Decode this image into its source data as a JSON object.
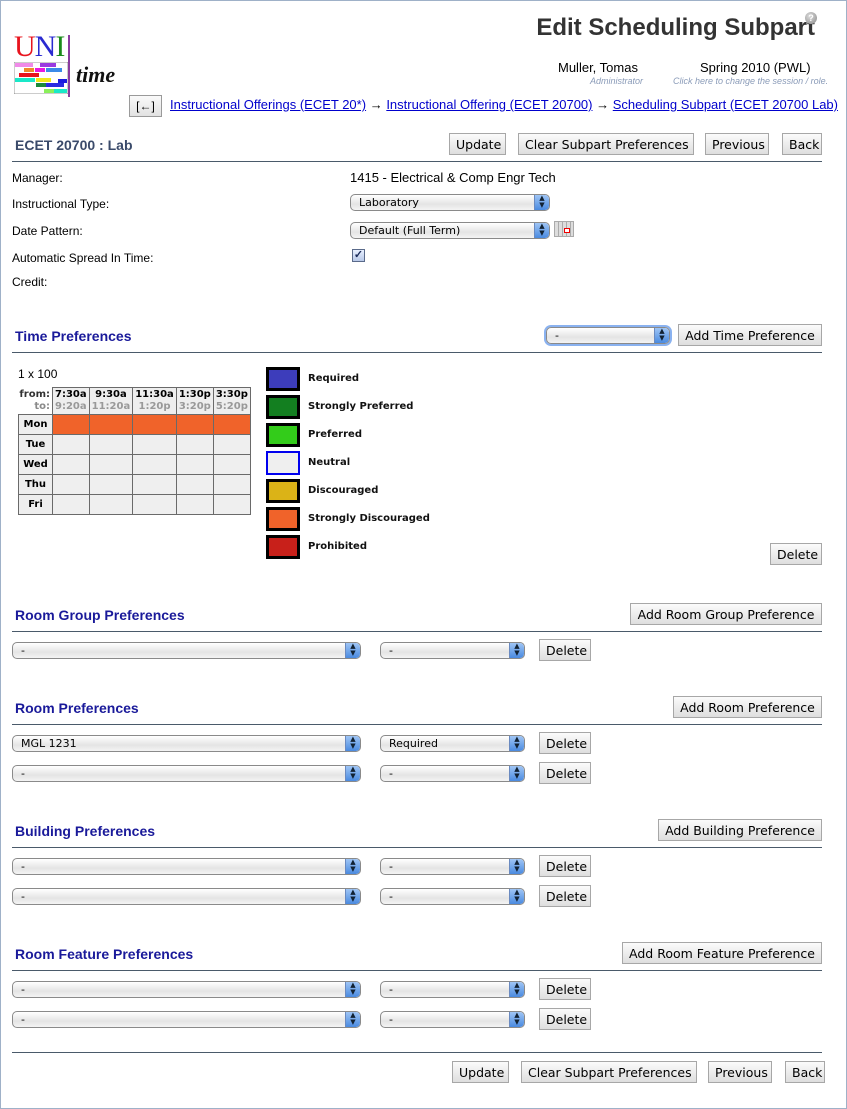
{
  "header": {
    "logo": {
      "uni_u": "U",
      "uni_n": "N",
      "uni_i": "I",
      "time": "time"
    },
    "page_title": "Edit Scheduling Subpart",
    "help_icon": "?",
    "user_name": "Muller, Tomas",
    "user_role": "Administrator",
    "session": "Spring 2010 (PWL)",
    "session_hint": "Click here to change the session / role.",
    "back_label": "[←]",
    "breadcrumb": [
      {
        "label": "Instructional Offerings (ECET 20*)"
      },
      {
        "label": "Instructional Offering (ECET 20700)"
      },
      {
        "label": "Scheduling Subpart (ECET 20700 Lab)"
      }
    ],
    "breadcrumb_separator": "→"
  },
  "subpart": {
    "title": "ECET  20700 : Lab",
    "buttons": {
      "update": "Update",
      "clear": "Clear Subpart Preferences",
      "previous": "Previous",
      "back": "Back"
    }
  },
  "fields": {
    "manager_label": "Manager:",
    "manager_value": "1415 - Electrical & Comp Engr Tech",
    "itype_label": "Instructional Type:",
    "itype_value": "Laboratory",
    "date_pattern_label": "Date Pattern:",
    "date_pattern_value": "Default (Full Term)",
    "auto_spread_label": "Automatic Spread In Time:",
    "auto_spread_checked": true,
    "auto_spread_mark": "✓",
    "credit_label": "Credit:"
  },
  "time_prefs": {
    "title": "Time Preferences",
    "pattern_select": "-",
    "add_label": "Add Time Preference",
    "pattern_name": "1 x 100",
    "from_label": "from:",
    "to_label": "to:",
    "columns": [
      {
        "from": "7:30a",
        "to": "9:20a"
      },
      {
        "from": "9:30a",
        "to": "11:20a"
      },
      {
        "from": "11:30a",
        "to": "1:20p"
      },
      {
        "from": "1:30p",
        "to": "3:20p"
      },
      {
        "from": "3:30p",
        "to": "5:20p"
      }
    ],
    "days": [
      {
        "day": "Mon",
        "prefs": [
          "Strongly Discouraged",
          "Strongly Discouraged",
          "Strongly Discouraged",
          "Strongly Discouraged",
          "Strongly Discouraged"
        ]
      },
      {
        "day": "Tue",
        "prefs": [
          "Neutral",
          "Neutral",
          "Neutral",
          "Neutral",
          "Neutral"
        ]
      },
      {
        "day": "Wed",
        "prefs": [
          "Neutral",
          "Neutral",
          "Neutral",
          "Neutral",
          "Neutral"
        ]
      },
      {
        "day": "Thu",
        "prefs": [
          "Neutral",
          "Neutral",
          "Neutral",
          "Neutral",
          "Neutral"
        ]
      },
      {
        "day": "Fri",
        "prefs": [
          "Neutral",
          "Neutral",
          "Neutral",
          "Neutral",
          "Neutral"
        ]
      }
    ],
    "legend": [
      {
        "label": "Required",
        "color": "#3d3dbb"
      },
      {
        "label": "Strongly Preferred",
        "color": "#137f20"
      },
      {
        "label": "Preferred",
        "color": "#33cc1a"
      },
      {
        "label": "Neutral",
        "color": "#efefef",
        "border": "#0000ee"
      },
      {
        "label": "Discouraged",
        "color": "#dbb317"
      },
      {
        "label": "Strongly Discouraged",
        "color": "#f0632a"
      },
      {
        "label": "Prohibited",
        "color": "#c8201a"
      }
    ],
    "delete_label": "Delete"
  },
  "room_group_prefs": {
    "title": "Room Group Preferences",
    "add_label": "Add Room Group Preference",
    "rows": [
      {
        "item": "-",
        "level": "-",
        "delete": "Delete"
      }
    ]
  },
  "room_prefs": {
    "title": "Room Preferences",
    "add_label": "Add Room Preference",
    "rows": [
      {
        "item": "MGL 1231",
        "level": "Required",
        "delete": "Delete"
      },
      {
        "item": "-",
        "level": "-",
        "delete": "Delete"
      }
    ]
  },
  "building_prefs": {
    "title": "Building Preferences",
    "add_label": "Add Building Preference",
    "rows": [
      {
        "item": "-",
        "level": "-",
        "delete": "Delete"
      },
      {
        "item": "-",
        "level": "-",
        "delete": "Delete"
      }
    ]
  },
  "room_feature_prefs": {
    "title": "Room Feature Preferences",
    "add_label": "Add Room Feature Preference",
    "rows": [
      {
        "item": "-",
        "level": "-",
        "delete": "Delete"
      },
      {
        "item": "-",
        "level": "-",
        "delete": "Delete"
      }
    ]
  },
  "footer": {
    "buttons": {
      "update": "Update",
      "clear": "Clear Subpart Preferences",
      "previous": "Previous",
      "back": "Back"
    }
  }
}
